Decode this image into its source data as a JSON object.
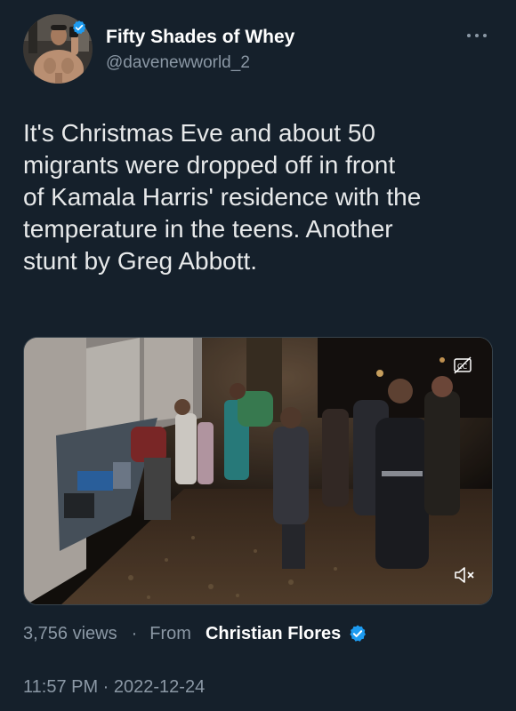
{
  "author": {
    "display_name": "Fifty Shades of Whey",
    "handle": "@davenewworld_2",
    "verified": true
  },
  "tweet": {
    "text": "It's Christmas Eve and about 50\nmigrants were dropped off in front\nof Kamala Harris' residence with the\ntemperature in the teens. Another\nstunt by Greg Abbott."
  },
  "media": {
    "type": "video",
    "captions_icon": "closed-captions-icon",
    "mute_icon": "muted-speaker-icon"
  },
  "meta": {
    "views": "3,756 views",
    "separator": "·",
    "from_label": "From",
    "source_name": "Christian Flores",
    "source_verified": true
  },
  "timestamp": "11:57 PM · 2022-12-24",
  "colors": {
    "background": "#15202b",
    "verified_blue": "#1d9bf0",
    "secondary_text": "#8b98a5",
    "primary_text": "#e7e9ea"
  },
  "icons": {
    "more": "more-horizontal-icon",
    "verified": "verified-badge-icon"
  }
}
